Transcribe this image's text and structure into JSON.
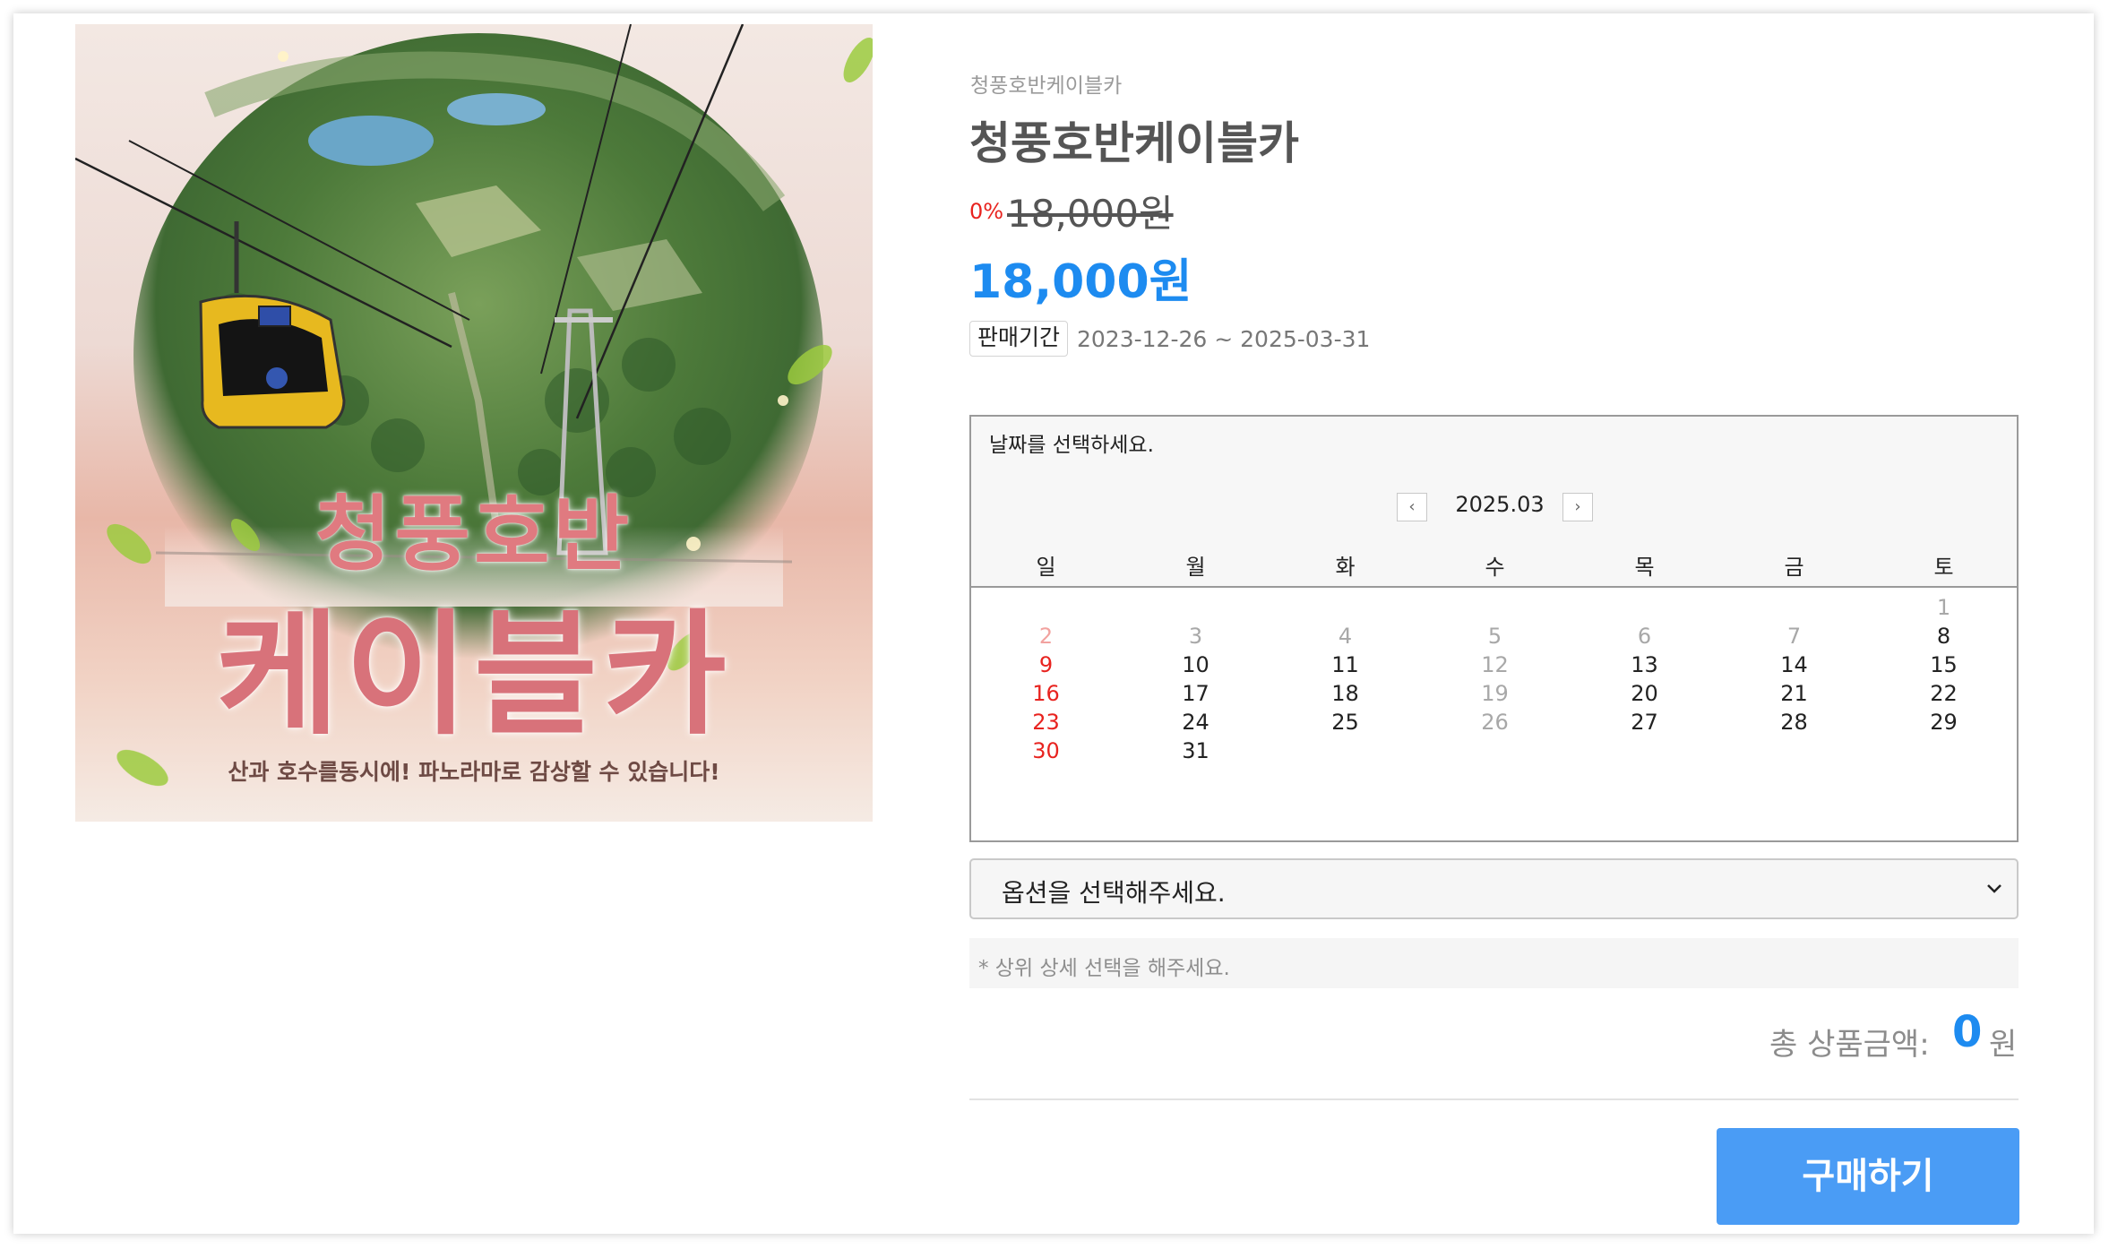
{
  "product": {
    "image_alt_title_top": "청풍호반",
    "image_alt_title_main": "케이블카",
    "image_caption": "산과 호수를동시에! 파노라마로 감상할 수 있습니다!",
    "brand": "청풍호반케이블카",
    "title": "청풍호반케이블카",
    "discount": "0%",
    "original_price": "18,000원",
    "price": "18,000원",
    "sale_period_label": "판매기간",
    "sale_period_value": "2023-12-26 ~ 2025-03-31"
  },
  "calendar": {
    "prompt": "날짜를 선택하세요.",
    "prev_icon": "chevron-left-icon",
    "next_icon": "chevron-right-icon",
    "month": "2025.03",
    "weekdays": [
      "일",
      "월",
      "화",
      "수",
      "목",
      "금",
      "토"
    ],
    "first_weekday_index": 6,
    "days": [
      {
        "d": "1",
        "state": "disabled"
      },
      {
        "d": "2",
        "state": "disabled-sunday"
      },
      {
        "d": "3",
        "state": "disabled"
      },
      {
        "d": "4",
        "state": "disabled"
      },
      {
        "d": "5",
        "state": "disabled"
      },
      {
        "d": "6",
        "state": "disabled"
      },
      {
        "d": "7",
        "state": "disabled"
      },
      {
        "d": "8",
        "state": "available"
      },
      {
        "d": "9",
        "state": "sunday"
      },
      {
        "d": "10",
        "state": "available"
      },
      {
        "d": "11",
        "state": "available"
      },
      {
        "d": "12",
        "state": "disabled"
      },
      {
        "d": "13",
        "state": "available"
      },
      {
        "d": "14",
        "state": "available"
      },
      {
        "d": "15",
        "state": "available"
      },
      {
        "d": "16",
        "state": "sunday"
      },
      {
        "d": "17",
        "state": "available"
      },
      {
        "d": "18",
        "state": "available"
      },
      {
        "d": "19",
        "state": "disabled"
      },
      {
        "d": "20",
        "state": "available"
      },
      {
        "d": "21",
        "state": "available"
      },
      {
        "d": "22",
        "state": "available"
      },
      {
        "d": "23",
        "state": "sunday"
      },
      {
        "d": "24",
        "state": "available"
      },
      {
        "d": "25",
        "state": "available"
      },
      {
        "d": "26",
        "state": "disabled"
      },
      {
        "d": "27",
        "state": "available"
      },
      {
        "d": "28",
        "state": "available"
      },
      {
        "d": "29",
        "state": "available"
      },
      {
        "d": "30",
        "state": "sunday"
      },
      {
        "d": "31",
        "state": "available"
      }
    ]
  },
  "option": {
    "placeholder": "옵션을 선택해주세요.",
    "note": "* 상위 상세 선택을 해주세요."
  },
  "total": {
    "label": "총 상품금액:",
    "value": "0",
    "unit": "원"
  },
  "buy_button": "구매하기",
  "colors": {
    "accent": "#1d8bf0",
    "button": "#4a9cf5",
    "sunday": "#e8231f",
    "disabled": "#a8a8a8",
    "disabled_sunday": "#f2a29f"
  }
}
